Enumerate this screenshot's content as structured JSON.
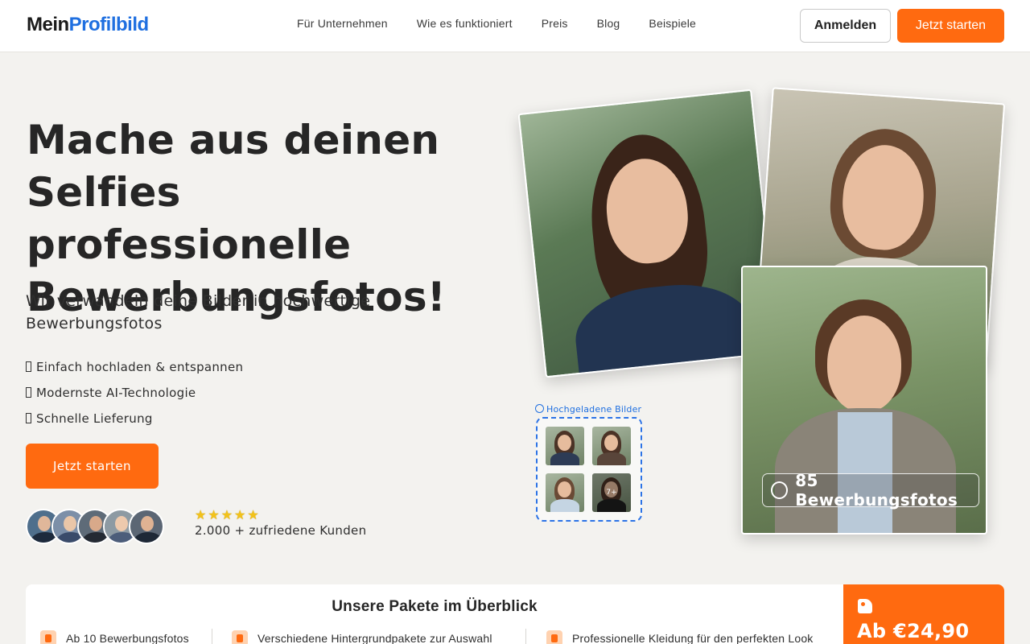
{
  "header": {
    "logo_part1": "Mein",
    "logo_part2": "Profilbild",
    "nav": [
      "Für Unternehmen",
      "Wie es funktioniert",
      "Preis",
      "Blog",
      "Beispiele"
    ],
    "login_label": "Anmelden",
    "start_label": "Jetzt starten"
  },
  "hero": {
    "title_line1": "Mache aus deinen",
    "title_line2": "Selfies professionelle",
    "title_line3": "Bewerbungsfotos!",
    "subtitle": "Wir verwandeln deine Bilder in hochwertige Bewerbungsfotos",
    "features": [
      "Einfach hochladen & entspannen",
      "Modernste AI-Technologie",
      "Schnelle Lieferung"
    ],
    "cta_label": "Jetzt starten",
    "stars": "★★★★★",
    "rating": 5,
    "customers": "2.000 + zufriedene Kunden"
  },
  "collage": {
    "upload_label": "Hochgeladene Bilder",
    "more_label": "7+",
    "result_badge": "85 Bewerbungsfotos"
  },
  "packages": {
    "title": "Unsere Pakete im Überblick",
    "items": [
      "Ab 10 Bewerbungsfotos",
      "Verschiedene Hintergrundpakete zur Auswahl",
      "Professionelle Kleidung für den perfekten Look"
    ],
    "price": "Ab €24,90"
  },
  "colors": {
    "accent": "#ff6a10",
    "brand_blue": "#1f6fe0",
    "background": "#f3f2ef"
  }
}
